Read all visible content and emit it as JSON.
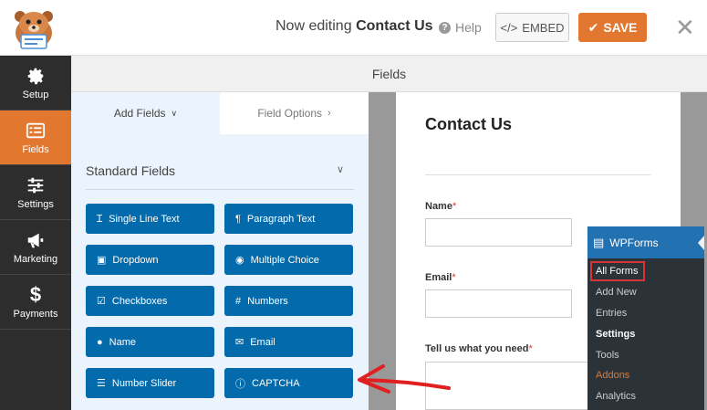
{
  "header": {
    "editing_prefix": "Now editing",
    "form_name": "Contact Us",
    "help_label": "Help",
    "embed_label": "EMBED",
    "save_label": "SAVE"
  },
  "sidebar": {
    "items": [
      {
        "label": "Setup",
        "icon": "gear-icon"
      },
      {
        "label": "Fields",
        "icon": "fields-list-icon"
      },
      {
        "label": "Settings",
        "icon": "sliders-icon"
      },
      {
        "label": "Marketing",
        "icon": "megaphone-icon"
      },
      {
        "label": "Payments",
        "icon": "dollar-icon"
      }
    ],
    "active": "Fields"
  },
  "panel_title": "Fields",
  "tabs": {
    "add_fields": "Add Fields",
    "field_options": "Field Options"
  },
  "standard_fields": {
    "title": "Standard Fields",
    "buttons": [
      {
        "label": "Single Line Text",
        "icon": "text-cursor-icon"
      },
      {
        "label": "Paragraph Text",
        "icon": "paragraph-icon"
      },
      {
        "label": "Dropdown",
        "icon": "dropdown-icon"
      },
      {
        "label": "Multiple Choice",
        "icon": "radio-icon"
      },
      {
        "label": "Checkboxes",
        "icon": "checkbox-icon"
      },
      {
        "label": "Numbers",
        "icon": "hash-icon"
      },
      {
        "label": "Name",
        "icon": "user-icon"
      },
      {
        "label": "Email",
        "icon": "envelope-icon"
      },
      {
        "label": "Number Slider",
        "icon": "sliders-icon"
      },
      {
        "label": "CAPTCHA",
        "icon": "question-circle-icon"
      }
    ]
  },
  "form_preview": {
    "title": "Contact Us",
    "fields": [
      {
        "label": "Name",
        "required": "*"
      },
      {
        "label": "Email",
        "required": "*"
      },
      {
        "label": "Tell us what you need",
        "required": "*"
      }
    ]
  },
  "wp_menu": {
    "title": "WPForms",
    "items": [
      "All Forms",
      "Add New",
      "Entries",
      "Settings",
      "Tools",
      "Addons",
      "Analytics"
    ]
  },
  "colors": {
    "accent": "#e27730",
    "button_blue": "#036aab",
    "wp_blue": "#2271b1",
    "highlight_red": "#d63638"
  }
}
